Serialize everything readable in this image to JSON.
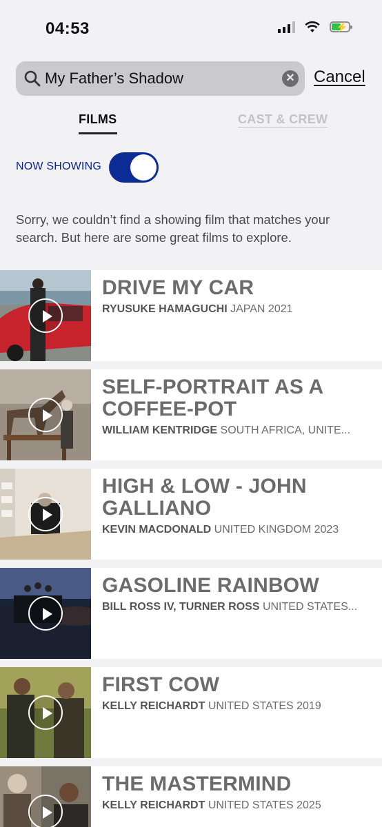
{
  "status_bar": {
    "time": "04:53"
  },
  "search": {
    "value": "My Father’s Shadow",
    "clear_icon": "x-circle-icon",
    "cancel_label": "Cancel"
  },
  "tabs": [
    {
      "label": "FILMS",
      "active": true
    },
    {
      "label": "CAST & CREW",
      "active": false
    }
  ],
  "toggle": {
    "label": "NOW SHOWING",
    "on": true,
    "color": "#0d2b95"
  },
  "message": "Sorry, we couldn’t find a showing film that matches your search. But here are some great films to explore.",
  "films": [
    {
      "title": "DRIVE MY CAR",
      "director": "RYUSUKE HAMAGUCHI",
      "info": "JAPAN 2021"
    },
    {
      "title": "SELF-PORTRAIT AS A COFFEE-POT",
      "director": "WILLIAM KENTRIDGE",
      "info": "SOUTH AFRICA, UNITE..."
    },
    {
      "title": "HIGH & LOW - JOHN GALLIANO",
      "director": "KEVIN MACDONALD",
      "info": "UNITED KINGDOM 2023"
    },
    {
      "title": "GASOLINE RAINBOW",
      "director": "BILL ROSS IV, TURNER ROSS",
      "info": "UNITED STATES..."
    },
    {
      "title": "FIRST COW",
      "director": "KELLY REICHARDT",
      "info": "UNITED STATES 2019"
    },
    {
      "title": "THE MASTERMIND",
      "director": "KELLY REICHARDT",
      "info": "UNITED STATES 2025"
    }
  ]
}
